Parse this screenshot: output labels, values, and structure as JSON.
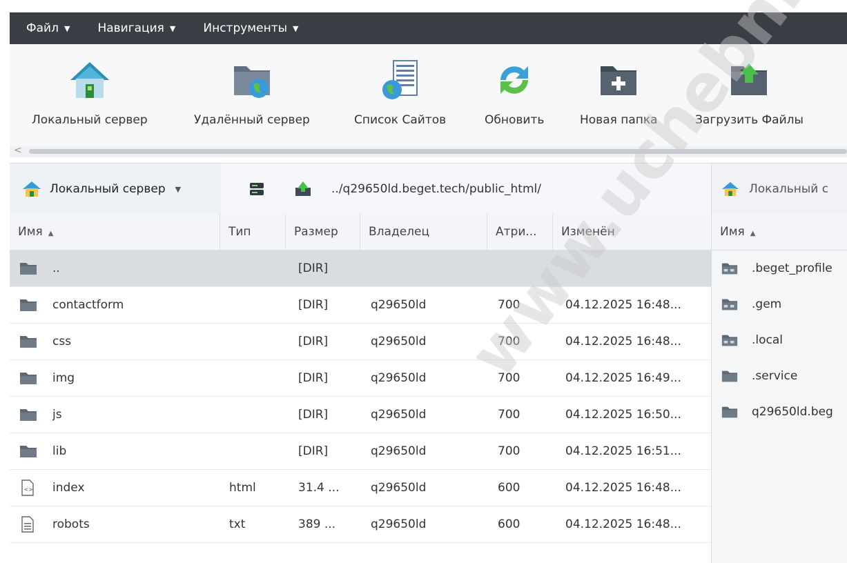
{
  "menu": [
    {
      "label": "Файл"
    },
    {
      "label": "Навигация"
    },
    {
      "label": "Инструменты"
    }
  ],
  "toolbar": [
    {
      "label": "Локальный сервер",
      "icon": "house-icon"
    },
    {
      "label": "Удалённый сервер",
      "icon": "folder-globe-icon"
    },
    {
      "label": "Список Сайтов",
      "icon": "document-globe-icon"
    },
    {
      "label": "Обновить",
      "icon": "refresh-icon"
    },
    {
      "label": "Новая папка",
      "icon": "new-folder-icon"
    },
    {
      "label": "Загрузить Файлы",
      "icon": "upload-folder-icon"
    }
  ],
  "pathbar": {
    "site_label": "Локальный сервер",
    "path": "../q29650ld.beget.tech/public_html/",
    "right_label": "Локальный с"
  },
  "left_table": {
    "columns": [
      "Имя",
      "Тип",
      "Размер",
      "Владелец",
      "Атри...",
      "Изменён"
    ],
    "rows": [
      {
        "name": "..",
        "type": "",
        "size": "[DIR]",
        "owner": "",
        "attr": "",
        "modified": "",
        "icon": "folder-icon"
      },
      {
        "name": "contactform",
        "type": "",
        "size": "[DIR]",
        "owner": "q29650ld",
        "attr": "700",
        "modified": "04.12.2025 16:48...",
        "icon": "folder-icon"
      },
      {
        "name": "css",
        "type": "",
        "size": "[DIR]",
        "owner": "q29650ld",
        "attr": "700",
        "modified": "04.12.2025 16:48...",
        "icon": "folder-icon"
      },
      {
        "name": "img",
        "type": "",
        "size": "[DIR]",
        "owner": "q29650ld",
        "attr": "700",
        "modified": "04.12.2025 16:49...",
        "icon": "folder-icon"
      },
      {
        "name": "js",
        "type": "",
        "size": "[DIR]",
        "owner": "q29650ld",
        "attr": "700",
        "modified": "04.12.2025 16:50...",
        "icon": "folder-icon"
      },
      {
        "name": "lib",
        "type": "",
        "size": "[DIR]",
        "owner": "q29650ld",
        "attr": "700",
        "modified": "04.12.2025 16:51...",
        "icon": "folder-icon"
      },
      {
        "name": "index",
        "type": "html",
        "size": "31.4 ...",
        "owner": "q29650ld",
        "attr": "600",
        "modified": "04.12.2025 16:48...",
        "icon": "html-file-icon"
      },
      {
        "name": "robots",
        "type": "txt",
        "size": "389 ...",
        "owner": "q29650ld",
        "attr": "600",
        "modified": "04.12.2025 16:48...",
        "icon": "text-file-icon"
      }
    ]
  },
  "right_table": {
    "column": "Имя",
    "rows": [
      {
        "name": ".beget_profile",
        "icon": "system-folder-icon"
      },
      {
        "name": ".gem",
        "icon": "system-folder-icon"
      },
      {
        "name": ".local",
        "icon": "system-folder-icon"
      },
      {
        "name": ".service",
        "icon": "folder-icon"
      },
      {
        "name": "q29650ld.beg",
        "icon": "folder-icon"
      }
    ]
  },
  "watermark": "www.uchebnik.ru"
}
